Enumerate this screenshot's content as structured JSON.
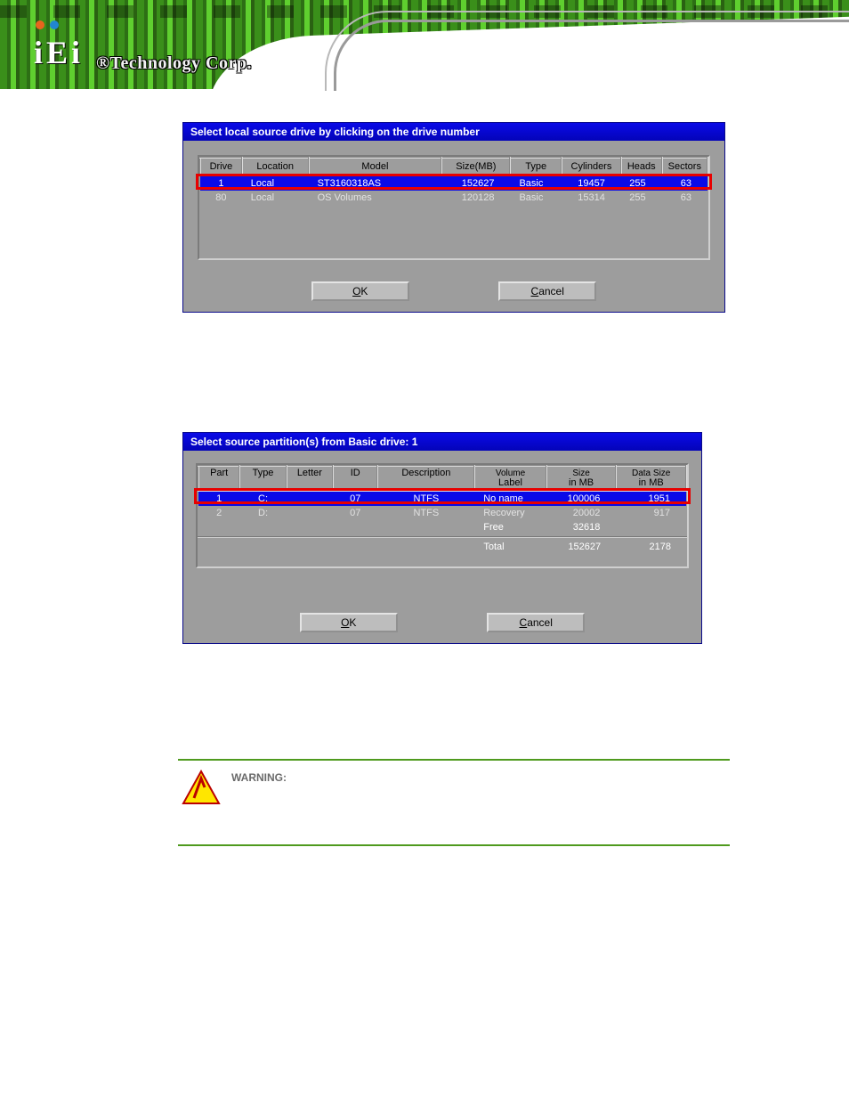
{
  "header": {
    "logo_letters": "iEi",
    "tech_text": "®Technology Corp."
  },
  "dialog1": {
    "title": "Select local source drive by clicking on the drive number",
    "columns": [
      "Drive",
      "Location",
      "Model",
      "Size(MB)",
      "Type",
      "Cylinders",
      "Heads",
      "Sectors"
    ],
    "rows": [
      {
        "selected": true,
        "cells": [
          "1",
          "Local",
          "ST3160318AS",
          "152627",
          "Basic",
          "19457",
          "255",
          "63"
        ]
      },
      {
        "selected": false,
        "cells": [
          "80",
          "Local",
          "OS Volumes",
          "120128",
          "Basic",
          "15314",
          "255",
          "63"
        ]
      }
    ],
    "ok_label": "OK",
    "cancel_label": "Cancel"
  },
  "dialog2": {
    "title": "Select source partition(s) from Basic drive: 1",
    "columns": [
      {
        "l1": "",
        "l2": "Part"
      },
      {
        "l1": "",
        "l2": "Type"
      },
      {
        "l1": "",
        "l2": "Letter"
      },
      {
        "l1": "",
        "l2": "ID"
      },
      {
        "l1": "",
        "l2": "Description"
      },
      {
        "l1": "Volume",
        "l2": "Label"
      },
      {
        "l1": "Size",
        "l2": "in MB"
      },
      {
        "l1": "Data Size",
        "l2": "in MB"
      }
    ],
    "rows": [
      {
        "selected": true,
        "cells": [
          "1",
          "C:",
          "",
          "07",
          "NTFS",
          "No name",
          "100006",
          "1951"
        ]
      },
      {
        "selected": false,
        "cells": [
          "2",
          "D:",
          "",
          "07",
          "NTFS",
          "Recovery",
          "20002",
          "917"
        ]
      }
    ],
    "free_row": [
      "",
      "",
      "",
      "",
      "",
      "Free",
      "32618",
      ""
    ],
    "total_row": [
      "",
      "",
      "",
      "",
      "",
      "Total",
      "152627",
      "2178"
    ],
    "ok_label": "OK",
    "cancel_label": "Cancel"
  },
  "warning": {
    "heading": "WARNING:"
  }
}
